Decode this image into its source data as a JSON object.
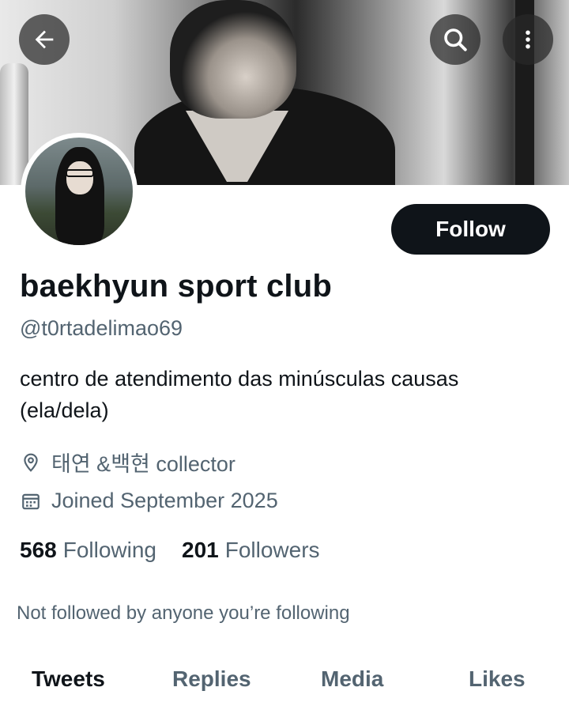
{
  "profile": {
    "display_name": "baekhyun sport club",
    "handle": "@t0rtadelimao69",
    "bio": "centro de atendimento das minúsculas causas (ela/dela)",
    "location": "태연 &백현 collector",
    "joined": "Joined September 2025",
    "following_count": "568",
    "following_label": "Following",
    "followers_count": "201",
    "followers_label": "Followers",
    "not_followed_text": "Not followed by anyone you’re following"
  },
  "actions": {
    "follow_label": "Follow"
  },
  "icons": {
    "back": "arrow-left-icon",
    "search": "search-icon",
    "more": "more-vertical-icon",
    "location": "location-pin-icon",
    "calendar": "calendar-icon"
  },
  "tabs": [
    {
      "label": "Tweets",
      "active": true
    },
    {
      "label": "Replies",
      "active": false
    },
    {
      "label": "Media",
      "active": false
    },
    {
      "label": "Likes",
      "active": false
    }
  ],
  "colors": {
    "primary_text": "#0f1419",
    "secondary_text": "#536471",
    "button_bg": "#0f1419",
    "background": "#ffffff"
  }
}
